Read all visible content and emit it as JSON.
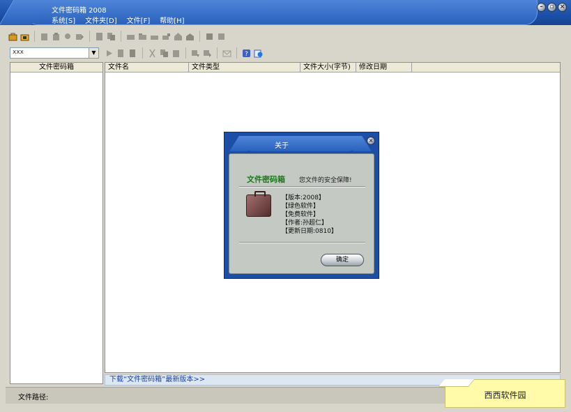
{
  "window": {
    "title": "文件密码箱 2008",
    "menu": [
      {
        "label": "系统[S]"
      },
      {
        "label": "文件夹[D]"
      },
      {
        "label": "文件[F]"
      },
      {
        "label": "帮助[H]"
      }
    ],
    "controls": [
      "minimize-icon",
      "restore-icon",
      "close-icon"
    ]
  },
  "toolbar": {
    "combo_value": "xxx"
  },
  "left_panel": {
    "header": "文件密码箱"
  },
  "file_list": {
    "columns": [
      {
        "label": "文件名"
      },
      {
        "label": "文件类型"
      },
      {
        "label": "文件大小(字节)"
      },
      {
        "label": "修改日期"
      }
    ]
  },
  "download_link": "下载“文件密码箱”最新版本>>",
  "status": {
    "path_label": "文件路径:"
  },
  "watermark": "西西软件园",
  "about_dialog": {
    "title": "关于",
    "app_name": "文件密码箱",
    "slogan": "您文件的安全保障!",
    "lines": [
      "【版本:2008】",
      "【绿色软件】",
      "【免费软件】",
      "【作者:孙超仁】",
      "【更新日期:0810】"
    ],
    "ok_label": "确定"
  },
  "colors": {
    "title_blue": "#2a61bd",
    "app_name_green": "#177a17",
    "link_blue": "#1a3fa8"
  }
}
